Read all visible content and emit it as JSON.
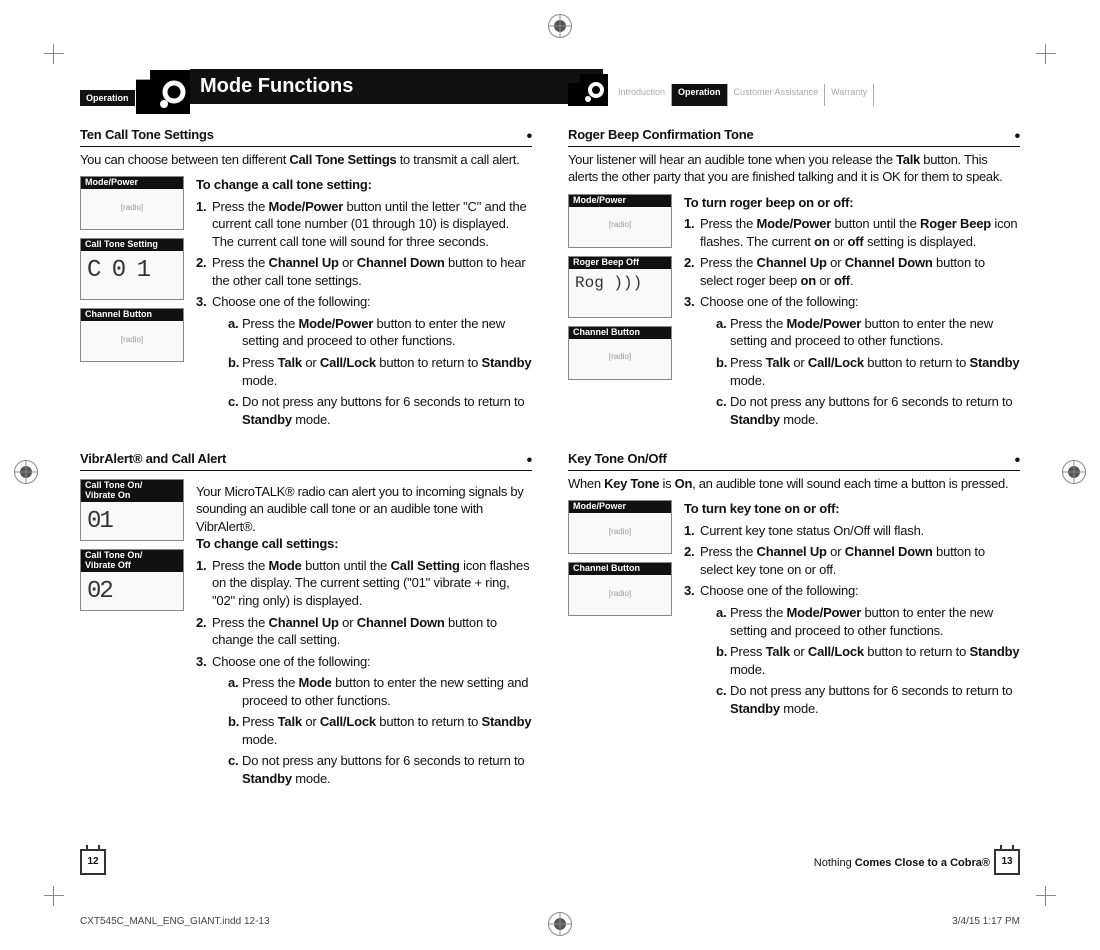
{
  "left": {
    "tab": "Operation",
    "title": "Mode Functions",
    "page_num": "12",
    "s1": {
      "title": "Ten Call Tone Settings",
      "intro": "You can choose between ten different <b>Call Tone Settings</b> to transmit a call alert.",
      "lead": "To change a call tone setting:",
      "caps": [
        "Mode/Power",
        "Call Tone Setting",
        "Channel Button"
      ],
      "lcd": "C 0 1",
      "n1": "Press the <b>Mode/Power</b> button until the letter \"C\" and the current call tone number (01 through 10) is displayed. The current call tone will sound for three seconds.",
      "n2": "Press the <b>Channel Up</b> or <b>Channel Down</b> button to hear the other call tone settings.",
      "n3": "Choose one of the following:",
      "a": "Press the <b>Mode/Power</b> button to enter the new setting and proceed to other functions.",
      "b": "Press <b>Talk</b> or <b>Call/Lock</b> button to return to <b>Standby</b> mode.",
      "c": "Do not press any buttons for 6 seconds to return to <b>Standby</b> mode."
    },
    "s2": {
      "title": "VibrAlert® and Call Alert",
      "intro": "Your MicroTALK® radio can alert you to incoming signals by sounding an audible call tone or an audible tone with VibrAlert®.",
      "lead": "To change call settings:",
      "caps": [
        "Call Tone On/\nVibrate On",
        "Call Tone On/\nVibrate Off"
      ],
      "lcd1": "01",
      "lcd2": "02",
      "n1": "Press the <b>Mode</b> button until the <b>Call Setting</b> icon flashes on the display. The current setting (\"01\" vibrate + ring, \"02\" ring only) is displayed.",
      "n2": "Press the <b>Channel Up</b> or <b>Channel Down</b> button to change the call setting.",
      "n3": "Choose one of the following:",
      "a": "Press the <b>Mode</b> button to enter the new setting and proceed to other functions.",
      "b": "Press <b>Talk</b> or <b>Call/Lock</b> button to return to <b>Standby</b> mode.",
      "c": "Do not press any buttons for 6 seconds to return to <b>Standby</b> mode."
    }
  },
  "right": {
    "tabs": [
      "Introduction",
      "Operation",
      "Customer Assistance",
      "Warranty"
    ],
    "active_tab": "Operation",
    "page_num": "13",
    "tagline_light": "Nothing",
    "tagline_bold": " Comes Close to a Cobra®",
    "s1": {
      "title": "Roger Beep Confirmation Tone",
      "intro": "Your listener will hear an audible tone when you release the <b>Talk</b> button. This alerts the other party that you are finished talking and it is OK for them to speak.",
      "lead": "To turn roger beep on or off:",
      "caps": [
        "Mode/Power",
        "Roger Beep Off",
        "Channel Button"
      ],
      "lcd": "Rog )))",
      "n1": "Press the <b>Mode/Power</b> button until the <b>Roger Beep</b> icon flashes. The current <b>on</b> or <b>off</b> setting is displayed.",
      "n2": "Press the <b>Channel Up</b> or <b>Channel Down</b> button to select roger beep <b>on</b> or <b>off</b>.",
      "n3": "Choose one of the following:",
      "a": "Press the <b>Mode/Power</b> button to enter the new setting and proceed to other functions.",
      "b": "Press <b>Talk</b> or <b>Call/Lock</b> button to return to <b>Standby</b> mode.",
      "c": "Do not press any buttons for 6 seconds to return to <b>Standby</b> mode."
    },
    "s2": {
      "title": "Key Tone On/Off",
      "intro": "When <b>Key Tone</b> is <b>On</b>, an audible tone will sound each time a button is pressed.",
      "lead": "To turn key tone on or off:",
      "caps": [
        "Mode/Power",
        "Channel Button"
      ],
      "n1": "Current key tone status On/Off will flash.",
      "n2": "Press the <b>Channel Up</b> or <b>Channel Down</b> button to select key tone on or off.",
      "n3": "Choose one of the following:",
      "a": "Press the <b>Mode/Power</b> button to enter the new setting and proceed to other functions.",
      "b": "Press <b>Talk</b> or <b>Call/Lock</b> button to return to <b>Standby</b> mode.",
      "c": "Do not press any buttons for 6 seconds to return to <b>Standby</b> mode."
    }
  },
  "slug_left": "CXT545C_MANL_ENG_GIANT.indd   12-13",
  "slug_right": "3/4/15   1:17 PM"
}
